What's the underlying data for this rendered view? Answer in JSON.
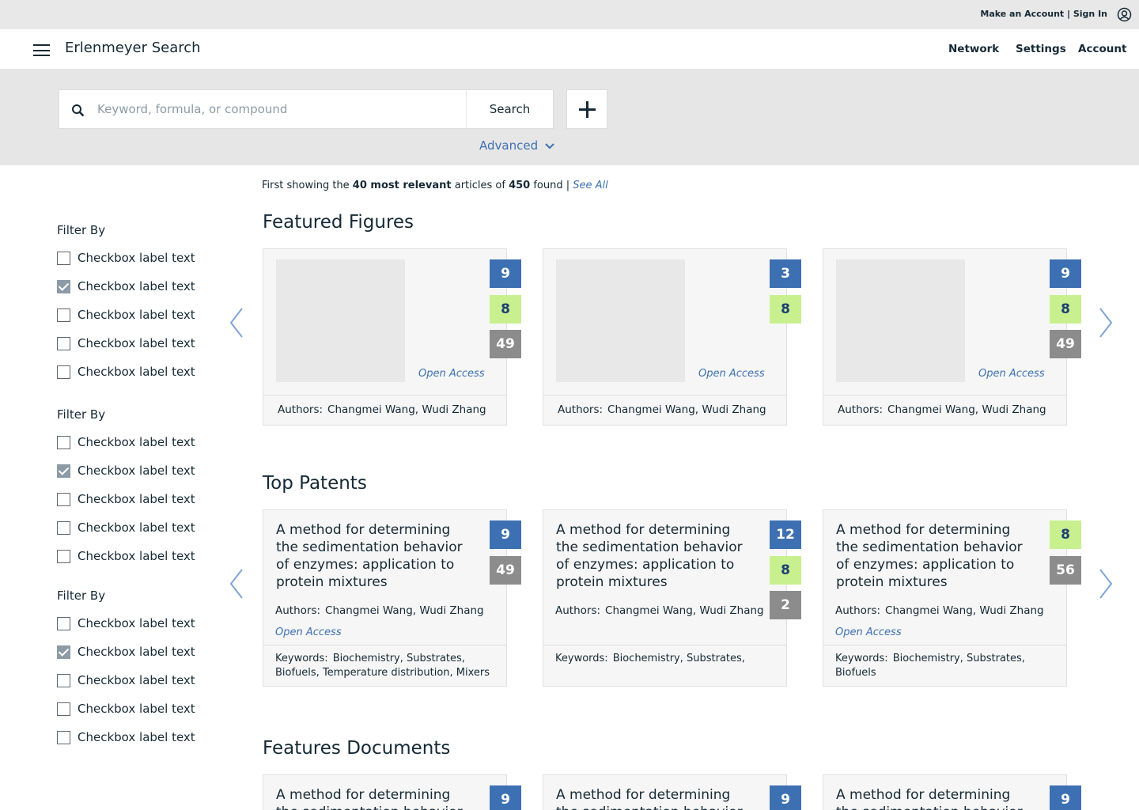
{
  "top_bar": {
    "signin_text": "Make an Account | Sign In",
    "user_icon": "user-circle-icon"
  },
  "nav": {
    "brand": "Erlenmeyer Search",
    "links": [
      "Network",
      "Settings",
      "Account"
    ],
    "menu_icon": "hamburger-menu-icon"
  },
  "search": {
    "placeholder": "Keyword, formula, or compound",
    "value": "",
    "button_label": "Search",
    "advanced_label": "Advanced"
  },
  "results": {
    "prefix": "First showing the ",
    "count_label": "40 most relevant",
    "middle": " articles of ",
    "total": "450",
    "suffix": " found | ",
    "see_all": "See All"
  },
  "filters": [
    {
      "title": "Filter By",
      "items": [
        {
          "label": "Checkbox label text",
          "checked": false
        },
        {
          "label": "Checkbox label text",
          "checked": true
        },
        {
          "label": "Checkbox label text",
          "checked": false
        },
        {
          "label": "Checkbox label text",
          "checked": false
        },
        {
          "label": "Checkbox label text",
          "checked": false
        }
      ]
    },
    {
      "title": "Filter By",
      "items": [
        {
          "label": "Checkbox label text",
          "checked": false
        },
        {
          "label": "Checkbox label text",
          "checked": true
        },
        {
          "label": "Checkbox label text",
          "checked": false
        },
        {
          "label": "Checkbox label text",
          "checked": false
        },
        {
          "label": "Checkbox label text",
          "checked": false
        }
      ]
    },
    {
      "title": "Filter By",
      "items": [
        {
          "label": "Checkbox label text",
          "checked": false
        },
        {
          "label": "Checkbox label text",
          "checked": true
        },
        {
          "label": "Checkbox label text",
          "checked": false
        },
        {
          "label": "Checkbox label text",
          "checked": false
        },
        {
          "label": "Checkbox label text",
          "checked": false
        }
      ]
    }
  ],
  "featured_figures": {
    "title": "Featured Figures",
    "cards": [
      {
        "badges": [
          {
            "value": "9",
            "color": "blue"
          },
          {
            "value": "8",
            "color": "green"
          },
          {
            "value": "49",
            "color": "gray"
          }
        ],
        "open_access": "Open Access",
        "authors_label": "Authors:",
        "authors": "Changmei Wang, Wudi Zhang"
      },
      {
        "badges": [
          {
            "value": "3",
            "color": "blue"
          },
          {
            "value": "8",
            "color": "green"
          }
        ],
        "open_access": "Open Access",
        "authors_label": "Authors:",
        "authors": "Changmei Wang, Wudi Zhang"
      },
      {
        "badges": [
          {
            "value": "9",
            "color": "blue"
          },
          {
            "value": "8",
            "color": "green"
          },
          {
            "value": "49",
            "color": "gray"
          }
        ],
        "open_access": "Open Access",
        "authors_label": "Authors:",
        "authors": "Changmei Wang, Wudi Zhang"
      }
    ]
  },
  "top_patents": {
    "title": "Top Patents",
    "cards": [
      {
        "title": "A method for determining the sedimentation behavior of enzymes: application to protein mixtures",
        "badges": [
          {
            "value": "9",
            "color": "blue"
          },
          {
            "value": "49",
            "color": "gray"
          }
        ],
        "authors_label": "Authors:",
        "authors": "Changmei Wang, Wudi Zhang",
        "open_access": "Open Access",
        "keywords_label": "Keywords:",
        "keywords": "Biochemistry, Substrates, Biofuels, Temperature distribution, Mixers"
      },
      {
        "title": "A method for determining the sedimentation behavior of enzymes: application to protein mixtures",
        "badges": [
          {
            "value": "12",
            "color": "blue"
          },
          {
            "value": "8",
            "color": "green"
          },
          {
            "value": "2",
            "color": "gray"
          }
        ],
        "authors_label": "Authors:",
        "authors": "Changmei Wang, Wudi Zhang",
        "open_access": "",
        "keywords_label": "Keywords:",
        "keywords": "Biochemistry, Substrates,"
      },
      {
        "title": "A method for determining the sedimentation behavior of enzymes: application to protein mixtures",
        "badges": [
          {
            "value": "8",
            "color": "green"
          },
          {
            "value": "56",
            "color": "gray"
          }
        ],
        "authors_label": "Authors:",
        "authors": "Changmei Wang, Wudi Zhang",
        "open_access": "Open Access",
        "keywords_label": "Keywords:",
        "keywords": "Biochemistry, Substrates, Biofuels"
      }
    ]
  },
  "features_documents": {
    "title": "Features Documents",
    "cards": [
      {
        "title": "A method for determining the sedimentation behavior",
        "badges": [
          {
            "value": "9",
            "color": "blue"
          }
        ]
      },
      {
        "title": "A method for determining the sedimentation behavior",
        "badges": [
          {
            "value": "9",
            "color": "blue"
          }
        ]
      },
      {
        "title": "A method for determining the sedimentation behavior",
        "badges": [
          {
            "value": "9",
            "color": "blue"
          }
        ]
      }
    ]
  },
  "icons": {
    "search": "search-icon",
    "prev": "chevron-left-icon",
    "next": "chevron-right-icon",
    "plus": "plus-icon",
    "advanced": "chevron-down-icon"
  }
}
